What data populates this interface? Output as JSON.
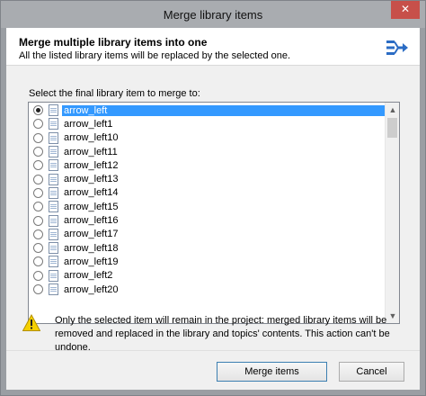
{
  "window": {
    "title": "Merge library items",
    "close_label": "✕"
  },
  "header": {
    "title": "Merge multiple library items into one",
    "subtitle": "All the listed library items will be replaced by the selected one.",
    "icon": "merge-arrows-icon"
  },
  "list": {
    "prompt": "Select the final library item to merge to:",
    "selected_index": 0,
    "items": [
      {
        "label": "arrow_left"
      },
      {
        "label": "arrow_left1"
      },
      {
        "label": "arrow_left10"
      },
      {
        "label": "arrow_left11"
      },
      {
        "label": "arrow_left12"
      },
      {
        "label": "arrow_left13"
      },
      {
        "label": "arrow_left14"
      },
      {
        "label": "arrow_left15"
      },
      {
        "label": "arrow_left16"
      },
      {
        "label": "arrow_left17"
      },
      {
        "label": "arrow_left18"
      },
      {
        "label": "arrow_left19"
      },
      {
        "label": "arrow_left2"
      },
      {
        "label": "arrow_left20"
      }
    ]
  },
  "warning": {
    "icon": "warning-icon",
    "text": "Only the selected item will remain in the project: merged library items will be removed and replaced in the library and topics' contents. This action can't be undone."
  },
  "buttons": {
    "merge": "Merge items",
    "cancel": "Cancel"
  },
  "colors": {
    "selection": "#3399ff",
    "close_button": "#c7504a",
    "warning_yellow": "#f5d000"
  }
}
